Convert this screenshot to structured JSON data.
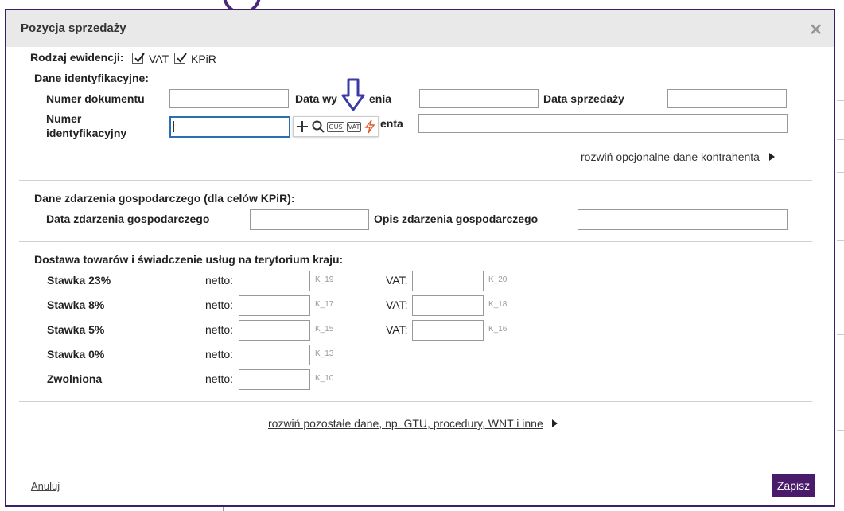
{
  "modal": {
    "title": "Pozycja sprzedaży",
    "close_icon": "close-icon"
  },
  "evidence": {
    "label": "Rodzaj ewidencji:",
    "options": [
      {
        "label": "VAT",
        "checked": true
      },
      {
        "label": "KPiR",
        "checked": true
      }
    ]
  },
  "identification": {
    "section_title": "Dane identyfikacyjne:",
    "doc_number_label": "Numer dokumentu",
    "issue_date_label": "Data wystawienia",
    "sale_date_label": "Data sprzedaży",
    "id_number_label_1": "Numer",
    "id_number_label_2": "identyfikacyjny",
    "contractor_label": "Nazwa kontrahenta",
    "contractor_label_visible": "enta",
    "issue_date_label_left": "Data wy",
    "issue_date_label_right": "enia",
    "toolbar": {
      "add_icon": "plus-icon",
      "search_icon": "search-icon",
      "gus": "GUS",
      "vat": "VAT",
      "lightning_icon": "lightning-icon"
    },
    "expand_link": "rozwiń opcjonalne dane kontrahenta"
  },
  "event": {
    "section_title": "Dane zdarzenia gospodarczego (dla celów KPiR):",
    "date_label": "Data zdarzenia gospodarczego",
    "desc_label": "Opis zdarzenia gospodarczego"
  },
  "supply": {
    "section_title": "Dostawa towarów i świadczenie usług na terytorium kraju:",
    "netto_label": "netto:",
    "vat_label": "VAT:",
    "rows": [
      {
        "rate": "Stawka 23%",
        "netto_code": "K_19",
        "vat_code": "K_20"
      },
      {
        "rate": "Stawka 8%",
        "netto_code": "K_17",
        "vat_code": "K_18"
      },
      {
        "rate": "Stawka 5%",
        "netto_code": "K_15",
        "vat_code": "K_16"
      },
      {
        "rate": "Stawka 0%",
        "netto_code": "K_13"
      },
      {
        "rate": "Zwolniona",
        "netto_code": "K_10"
      }
    ]
  },
  "more_link": "rozwiń pozostałe dane, np. GTU, procedury, WNT i inne",
  "footer": {
    "cancel": "Anuluj",
    "save": "Zapisz"
  },
  "colors": {
    "accent": "#4a1a6b",
    "focus": "#2a6fb0",
    "annotation_arrow": "#3a3aa8"
  }
}
